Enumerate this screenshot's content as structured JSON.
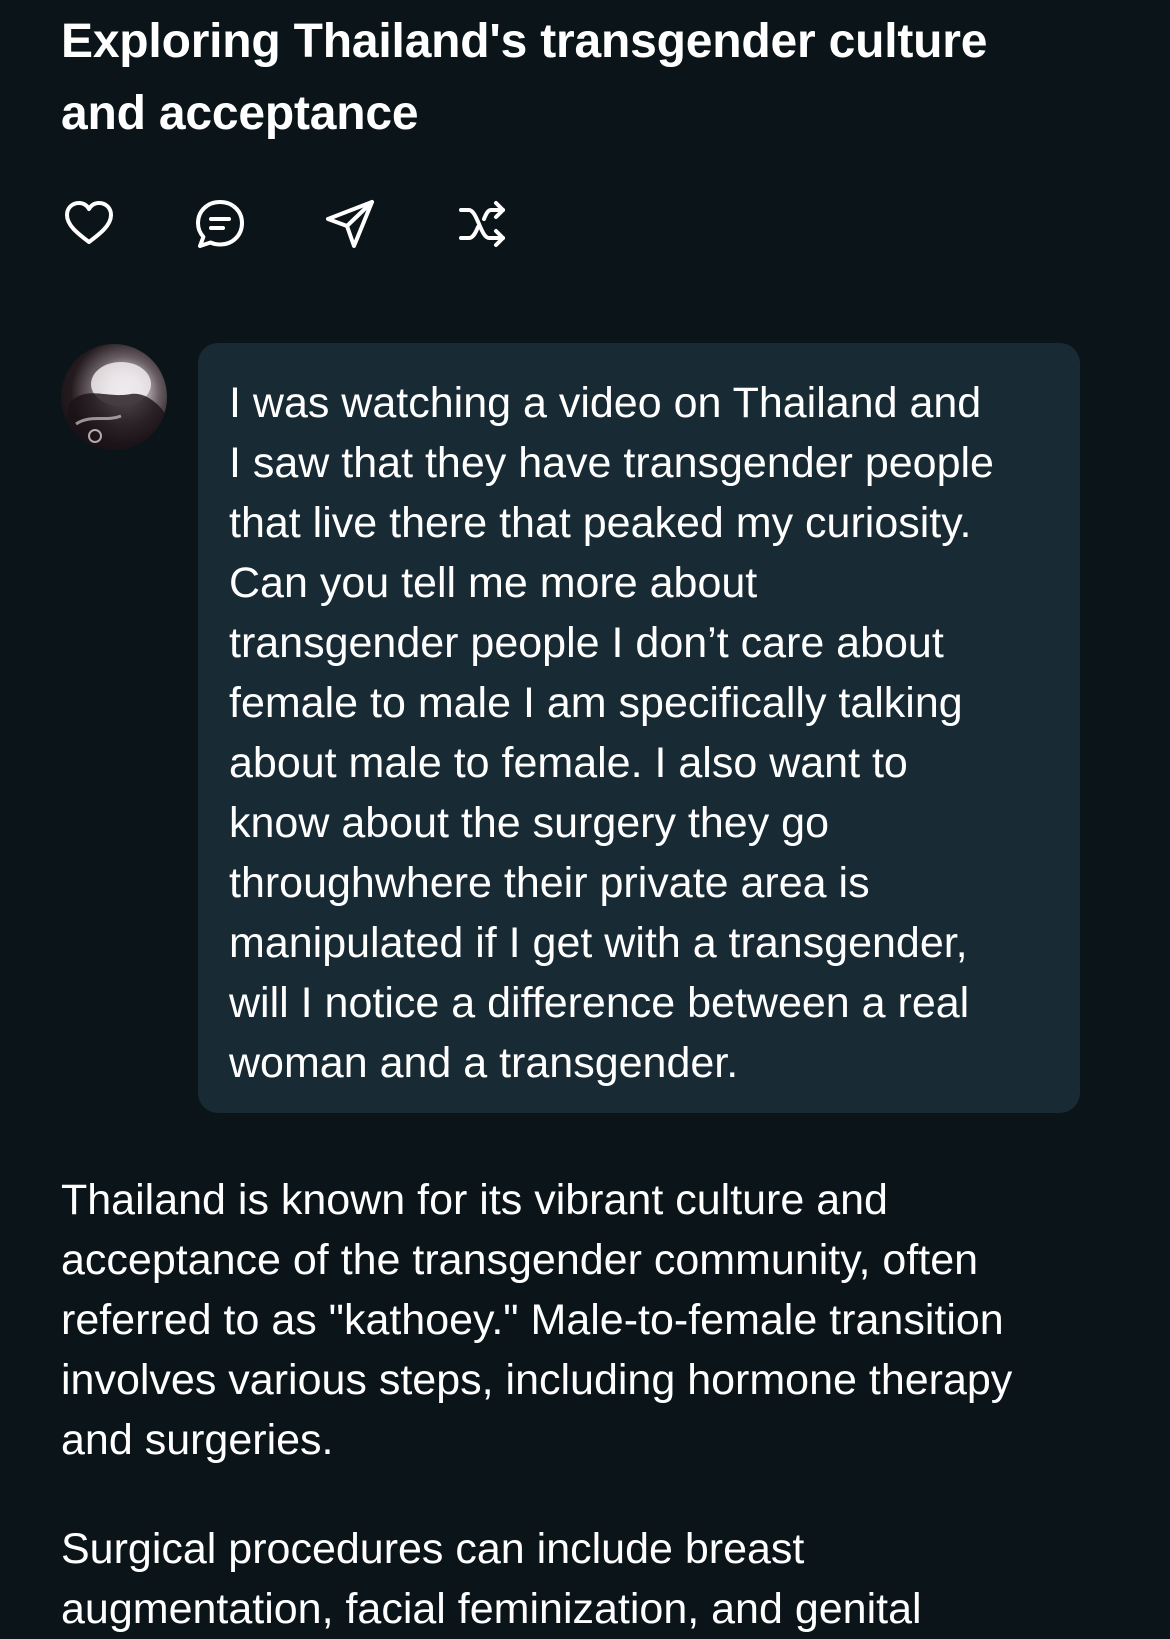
{
  "header": {
    "title": "Exploring Thailand's transgender culture and acceptance"
  },
  "actions": [
    {
      "icon": "heart-icon"
    },
    {
      "icon": "comment-icon"
    },
    {
      "icon": "share-icon"
    },
    {
      "icon": "shuffle-icon"
    }
  ],
  "conversation": {
    "user_message": "I was watching a video on Thailand and\nI saw that they have transgender people\nthat live there that peaked my curiosity.\nCan you tell me more about\ntransgender people I don’t care about\nfemale to male I am specifically talking\nabout male to female. I also want to\nknow about the surgery they go\nthroughwhere their private area is\nmanipulated if I get with a transgender,\nwill I notice a difference between a real\nwoman and a transgender.",
    "response_paragraphs": [
      "Thailand is known for its vibrant culture and\nacceptance of the transgender community, often\nreferred to as \"kathoey.\" Male-to-female transition\ninvolves various steps, including hormone therapy\nand surgeries.",
      "Surgical procedures can include breast\naugmentation, facial feminization, and genital"
    ]
  },
  "colors": {
    "background": "#0b1418",
    "bubble": "#182a33",
    "text": "#ffffff"
  }
}
